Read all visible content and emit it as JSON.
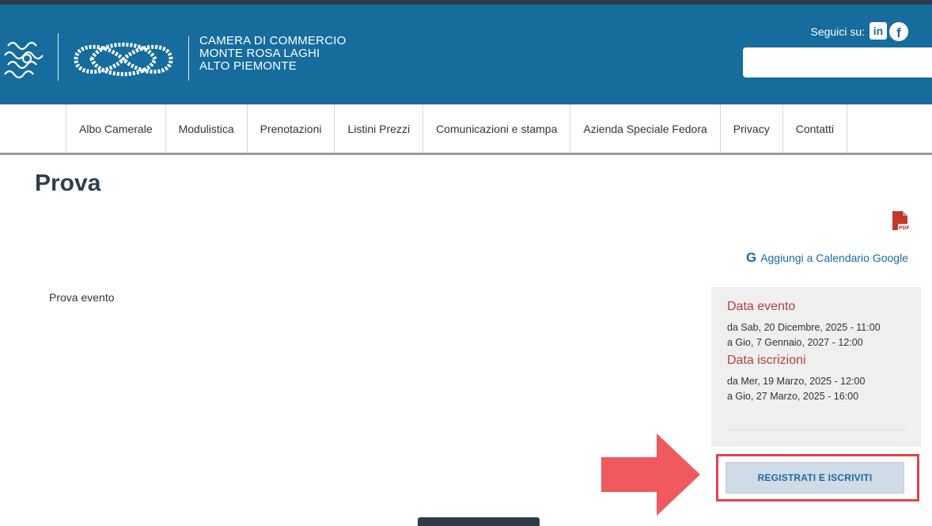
{
  "header": {
    "org_name_lines": [
      "CAMERA DI COMMERCIO",
      "MONTE ROSA LAGHI",
      "ALTO PIEMONTE"
    ],
    "follow_label": "Seguici su:",
    "social": [
      {
        "name": "linkedin-icon",
        "label": "in"
      },
      {
        "name": "facebook-icon",
        "label": "f"
      }
    ],
    "search": {
      "value": "",
      "placeholder": ""
    }
  },
  "nav": {
    "items": [
      "Albo Camerale",
      "Modulistica",
      "Prenotazioni",
      "Listini Prezzi",
      "Comunicazioni e stampa",
      "Azienda Speciale Fedora",
      "Privacy",
      "Contatti"
    ]
  },
  "main": {
    "title": "Prova",
    "pdf_icon": "pdf-icon",
    "gcal_letter": "G",
    "gcal_label": "Aggiungi a Calendario Google",
    "body_text": "Prova evento"
  },
  "event_box": {
    "event_date_title": "Data evento",
    "event_from": "da Sab, 20 Dicembre, 2025 - 11:00",
    "event_to": "a Gio, 7 Gennaio, 2027 - 12:00",
    "signup_title": "Data iscrizioni",
    "signup_from": "da Mer, 19 Marzo, 2025 - 12:00",
    "signup_to": "a Gio, 27 Marzo, 2025 - 16:00"
  },
  "register_button": {
    "label": "REGISTRATI E ISCRIVITI"
  },
  "colors": {
    "header_blue": "#156c9d",
    "accent_red": "#b0413e",
    "arrow_red": "#f05a5f",
    "link_blue": "#1a6aa0"
  }
}
